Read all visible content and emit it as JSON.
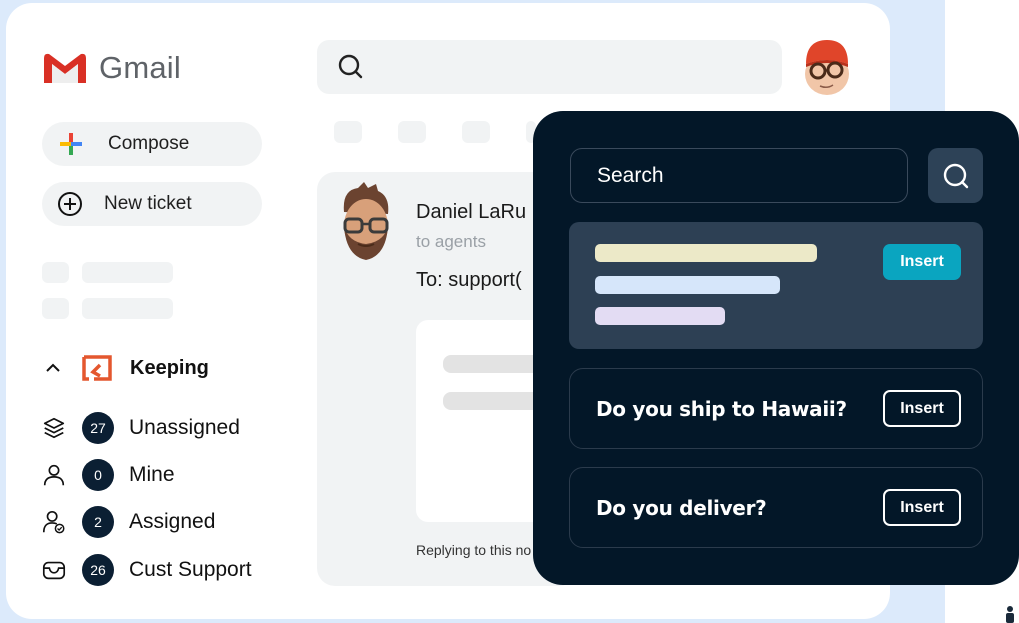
{
  "app": {
    "name": "Gmail"
  },
  "sidebar": {
    "compose_label": "Compose",
    "new_ticket_label": "New ticket",
    "section": {
      "label": "Keeping",
      "expanded": true
    },
    "items": [
      {
        "label": "Unassigned",
        "count": "27",
        "icon": "layers-icon"
      },
      {
        "label": "Mine",
        "count": "0",
        "icon": "user-icon"
      },
      {
        "label": "Assigned",
        "count": "2",
        "icon": "user-check-icon"
      },
      {
        "label": "Cust Support",
        "count": "26",
        "icon": "inbox-icon"
      }
    ]
  },
  "email": {
    "sender": "Daniel LaRu",
    "recipient_note": "to agents",
    "to_line": "To: support(",
    "reply_note": "Replying to this no"
  },
  "panel": {
    "search_placeholder": "Search",
    "insert_label": "Insert",
    "results": [
      {
        "question": "Do you ship to Hawaii?"
      },
      {
        "question": "Do you deliver?"
      }
    ]
  },
  "colors": {
    "brand_accent": "#0aa5c0",
    "panel_bg": "#031728",
    "badge_bg": "#0b1f33",
    "keeping_brand": "#e4572e",
    "page_bg_blue": "#dceafb"
  }
}
